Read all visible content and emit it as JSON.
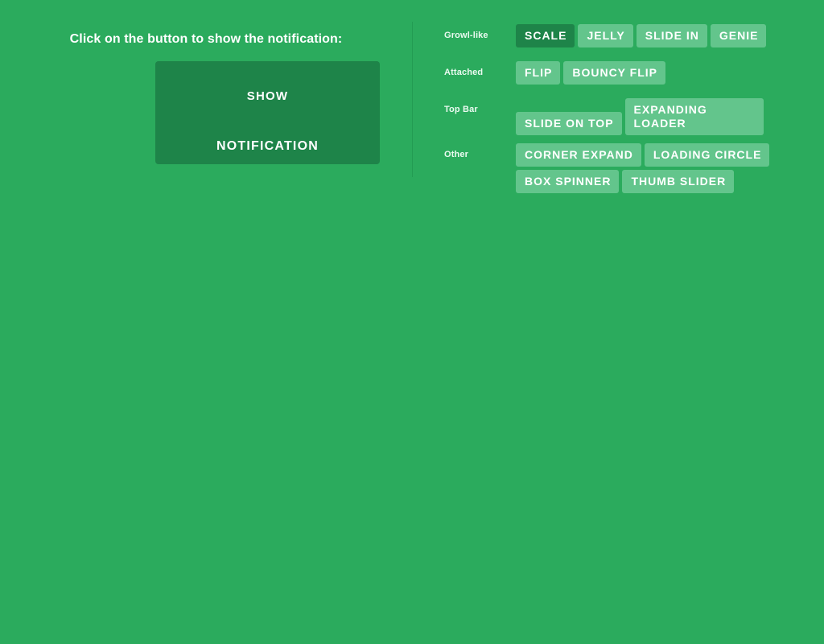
{
  "theme": {
    "background": "#2bab5d",
    "button_active": "#1e8449",
    "button_default": "#63c58c",
    "divider": "#239b53",
    "text": "#ffffff",
    "label_text": "#eafaf0"
  },
  "left": {
    "heading": "Click on the button to show the notification:",
    "trigger_button": {
      "line1": "SHOW",
      "line2": "NOTIFICATION"
    }
  },
  "right": {
    "rows": [
      {
        "label": "Growl-like",
        "buttons": [
          {
            "label": "SCALE",
            "active": true
          },
          {
            "label": "JELLY",
            "active": false
          },
          {
            "label": "SLIDE IN",
            "active": false
          },
          {
            "label": "GENIE",
            "active": false
          }
        ]
      },
      {
        "label": "Attached",
        "buttons": [
          {
            "label": "FLIP",
            "active": false
          },
          {
            "label": "BOUNCY FLIP",
            "active": false
          }
        ]
      },
      {
        "label": "Top Bar",
        "buttons": [
          {
            "label": "SLIDE ON TOP",
            "active": false
          },
          {
            "label": "EXPANDING LOADER",
            "active": false
          }
        ]
      },
      {
        "label": "Other",
        "buttons": [
          {
            "label": "CORNER EXPAND",
            "active": false
          },
          {
            "label": "LOADING CIRCLE",
            "active": false
          },
          {
            "label": "BOX SPINNER",
            "active": false
          },
          {
            "label": "THUMB SLIDER",
            "active": false
          }
        ]
      }
    ]
  }
}
